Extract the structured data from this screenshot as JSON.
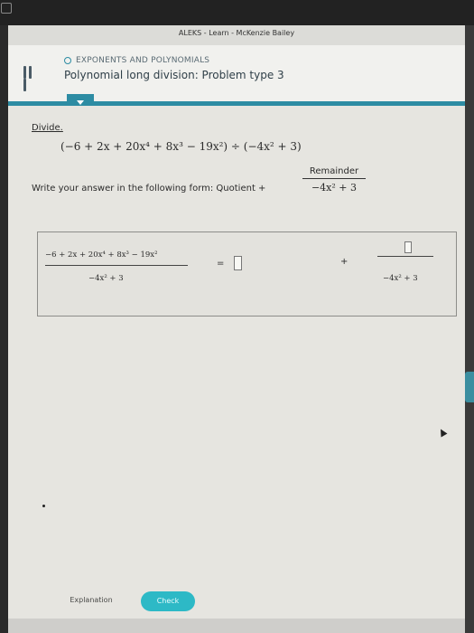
{
  "window": {
    "title": "ALEKS - Learn - McKenzie Bailey"
  },
  "header": {
    "topic": "EXPONENTS AND POLYNOMIALS",
    "problem_title": "Polynomial long division: Problem type 3",
    "accent_color": "#2d8ca3"
  },
  "problem": {
    "divide_label": "Divide.",
    "expression": "(−6 + 2x + 20x⁴ + 8x³ − 19x²) ÷ (−4x² + 3)",
    "instruction": "Write your answer in the following form: Quotient +",
    "form_numerator": "Remainder",
    "form_denominator": "−4x² + 3"
  },
  "answer": {
    "dividend": "−6 + 2x + 20x⁴ + 8x³ − 19x²",
    "divisor": "−4x² + 3",
    "equals": "=",
    "quotient_value": "",
    "plus": "+",
    "remainder_value": "",
    "remainder_denominator": "−4x² + 3"
  },
  "buttons": {
    "explanation": "Explanation",
    "check": "Check",
    "check_color": "#2db9c6"
  }
}
